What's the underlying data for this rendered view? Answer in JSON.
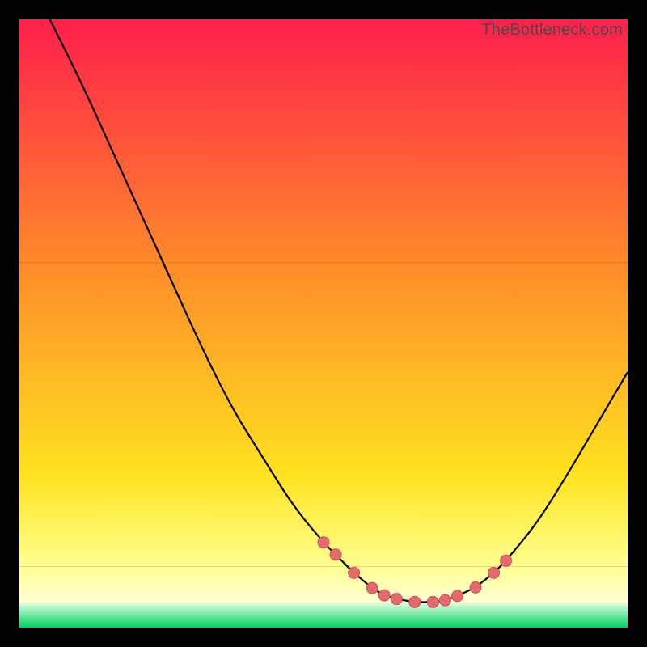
{
  "watermark": "TheBottleneck.com",
  "colors": {
    "bg": "#000000",
    "grad_top": "#ff1f4b",
    "grad_upper_mid": "#ff6a2a",
    "grad_mid": "#ffd21f",
    "grad_lower": "#ffff66",
    "grad_pale": "#ffffc0",
    "grad_green": "#00d060",
    "curve": "#000000",
    "marker_fill": "#e46a6e",
    "marker_stroke": "#c94f55"
  },
  "chart_data": {
    "type": "line",
    "title": "",
    "xlabel": "",
    "ylabel": "",
    "xlim": [
      0,
      100
    ],
    "ylim": [
      0,
      100
    ],
    "series": [
      {
        "name": "bottleneck-curve",
        "x": [
          5,
          10,
          15,
          20,
          25,
          30,
          35,
          40,
          45,
          50,
          52,
          55,
          58,
          60,
          62,
          65,
          68,
          70,
          72,
          75,
          78,
          80,
          85,
          90,
          95,
          100
        ],
        "y": [
          100,
          90,
          79,
          68,
          57,
          46,
          36,
          28,
          20,
          14,
          12,
          9,
          6.5,
          5.3,
          4.7,
          4.2,
          4.2,
          4.5,
          5.2,
          6.6,
          9,
          11,
          17,
          25,
          33.5,
          42
        ]
      }
    ],
    "markers": {
      "name": "highlighted-points",
      "x": [
        50,
        52,
        55,
        58,
        60,
        62,
        65,
        68,
        70,
        72,
        75,
        78,
        80
      ],
      "y": [
        14,
        12,
        9,
        6.5,
        5.3,
        4.7,
        4.2,
        4.2,
        4.5,
        5.2,
        6.6,
        9,
        11
      ]
    },
    "gradient_bands": [
      {
        "y0": 100,
        "y1": 60,
        "from": "#ff1f4b",
        "to": "#ff8a2a"
      },
      {
        "y0": 60,
        "y1": 25,
        "from": "#ff8a2a",
        "to": "#ffe21f"
      },
      {
        "y0": 25,
        "y1": 10,
        "from": "#ffe21f",
        "to": "#ffff90"
      },
      {
        "y0": 10,
        "y1": 4,
        "from": "#ffff90",
        "to": "#ffffd8"
      },
      {
        "y0": 4,
        "y1": 0,
        "from": "#d8ffe0",
        "to": "#00d060"
      }
    ]
  }
}
